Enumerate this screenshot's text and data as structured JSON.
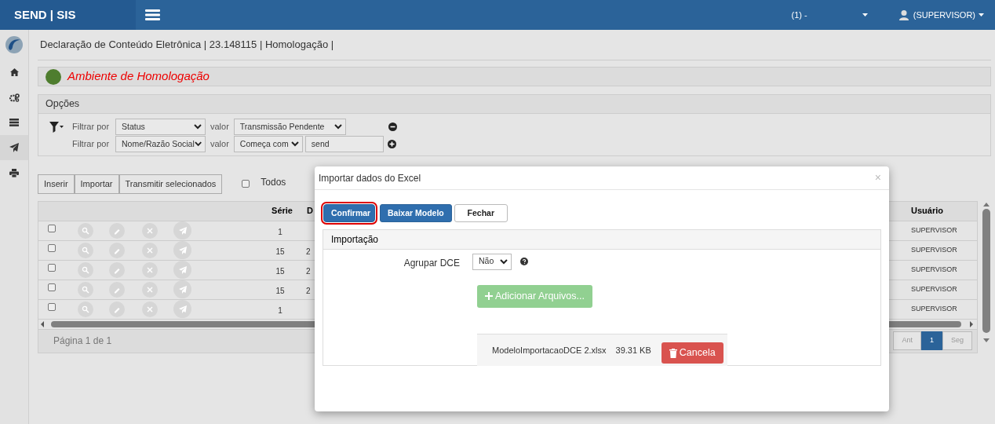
{
  "navbar": {
    "brand": "SEND | SIS",
    "company": "(1) -",
    "user": "(SUPERVISOR)"
  },
  "breadcrumb": "Declaração de Conteúdo Eletrônica | 23.148115 | Homologação |",
  "environment": {
    "label": "Ambiente de Homologação"
  },
  "options": {
    "title": "Opções",
    "filters": [
      {
        "label": "Filtrar por",
        "field": "Status",
        "value_label": "valor",
        "kind": "select",
        "value": "Transmissão Pendente",
        "removable": true
      },
      {
        "label": "Filtrar por",
        "field": "Nome/Razão Social",
        "value_label": "valor",
        "kind": "text",
        "operator": "Começa com",
        "value": "send",
        "removable": false
      }
    ]
  },
  "toolbar": {
    "buttons": [
      "Inserir",
      "Importar",
      "Transmitir selecionados"
    ],
    "select_all": {
      "label": "Todos",
      "checked": false
    }
  },
  "table": {
    "columns": [
      "Série",
      "D",
      "Usuário"
    ],
    "rows": [
      {
        "checked": false,
        "serie": "1",
        "usuario": "SUPERVISOR"
      },
      {
        "checked": false,
        "serie": "15",
        "column_2": "2",
        "usuario": "SUPERVISOR"
      },
      {
        "checked": false,
        "serie": "15",
        "column_2": "2",
        "usuario": "SUPERVISOR"
      },
      {
        "checked": false,
        "serie": "15",
        "column_2": "2",
        "usuario": "SUPERVISOR"
      },
      {
        "checked": false,
        "serie": "1",
        "usuario": "SUPERVISOR"
      }
    ]
  },
  "pager": {
    "summary": "Página 1 de 1",
    "pages": [
      {
        "label": "Ant",
        "selected": false
      },
      {
        "label": "1",
        "selected": true
      },
      {
        "label": "Seg",
        "selected": false
      }
    ]
  },
  "modal": {
    "title": "Importar dados do Excel",
    "close": "×",
    "buttons": [
      {
        "label": "Confirmar",
        "kind": "primary",
        "focused": true
      },
      {
        "label": "Baixar Modelo",
        "kind": "primary",
        "focused": false
      },
      {
        "label": "Fechar",
        "kind": "default",
        "focused": false
      }
    ],
    "section": "Importação",
    "group_label": "Agrupar DCE",
    "group_value": "Não",
    "add_files": "Adicionar Arquivos...",
    "add_disabled": true,
    "files": [
      {
        "name": "ModeloImportacaoDCE 2.xlsx",
        "size": "39.31 KB",
        "action": "Cancela"
      }
    ]
  }
}
